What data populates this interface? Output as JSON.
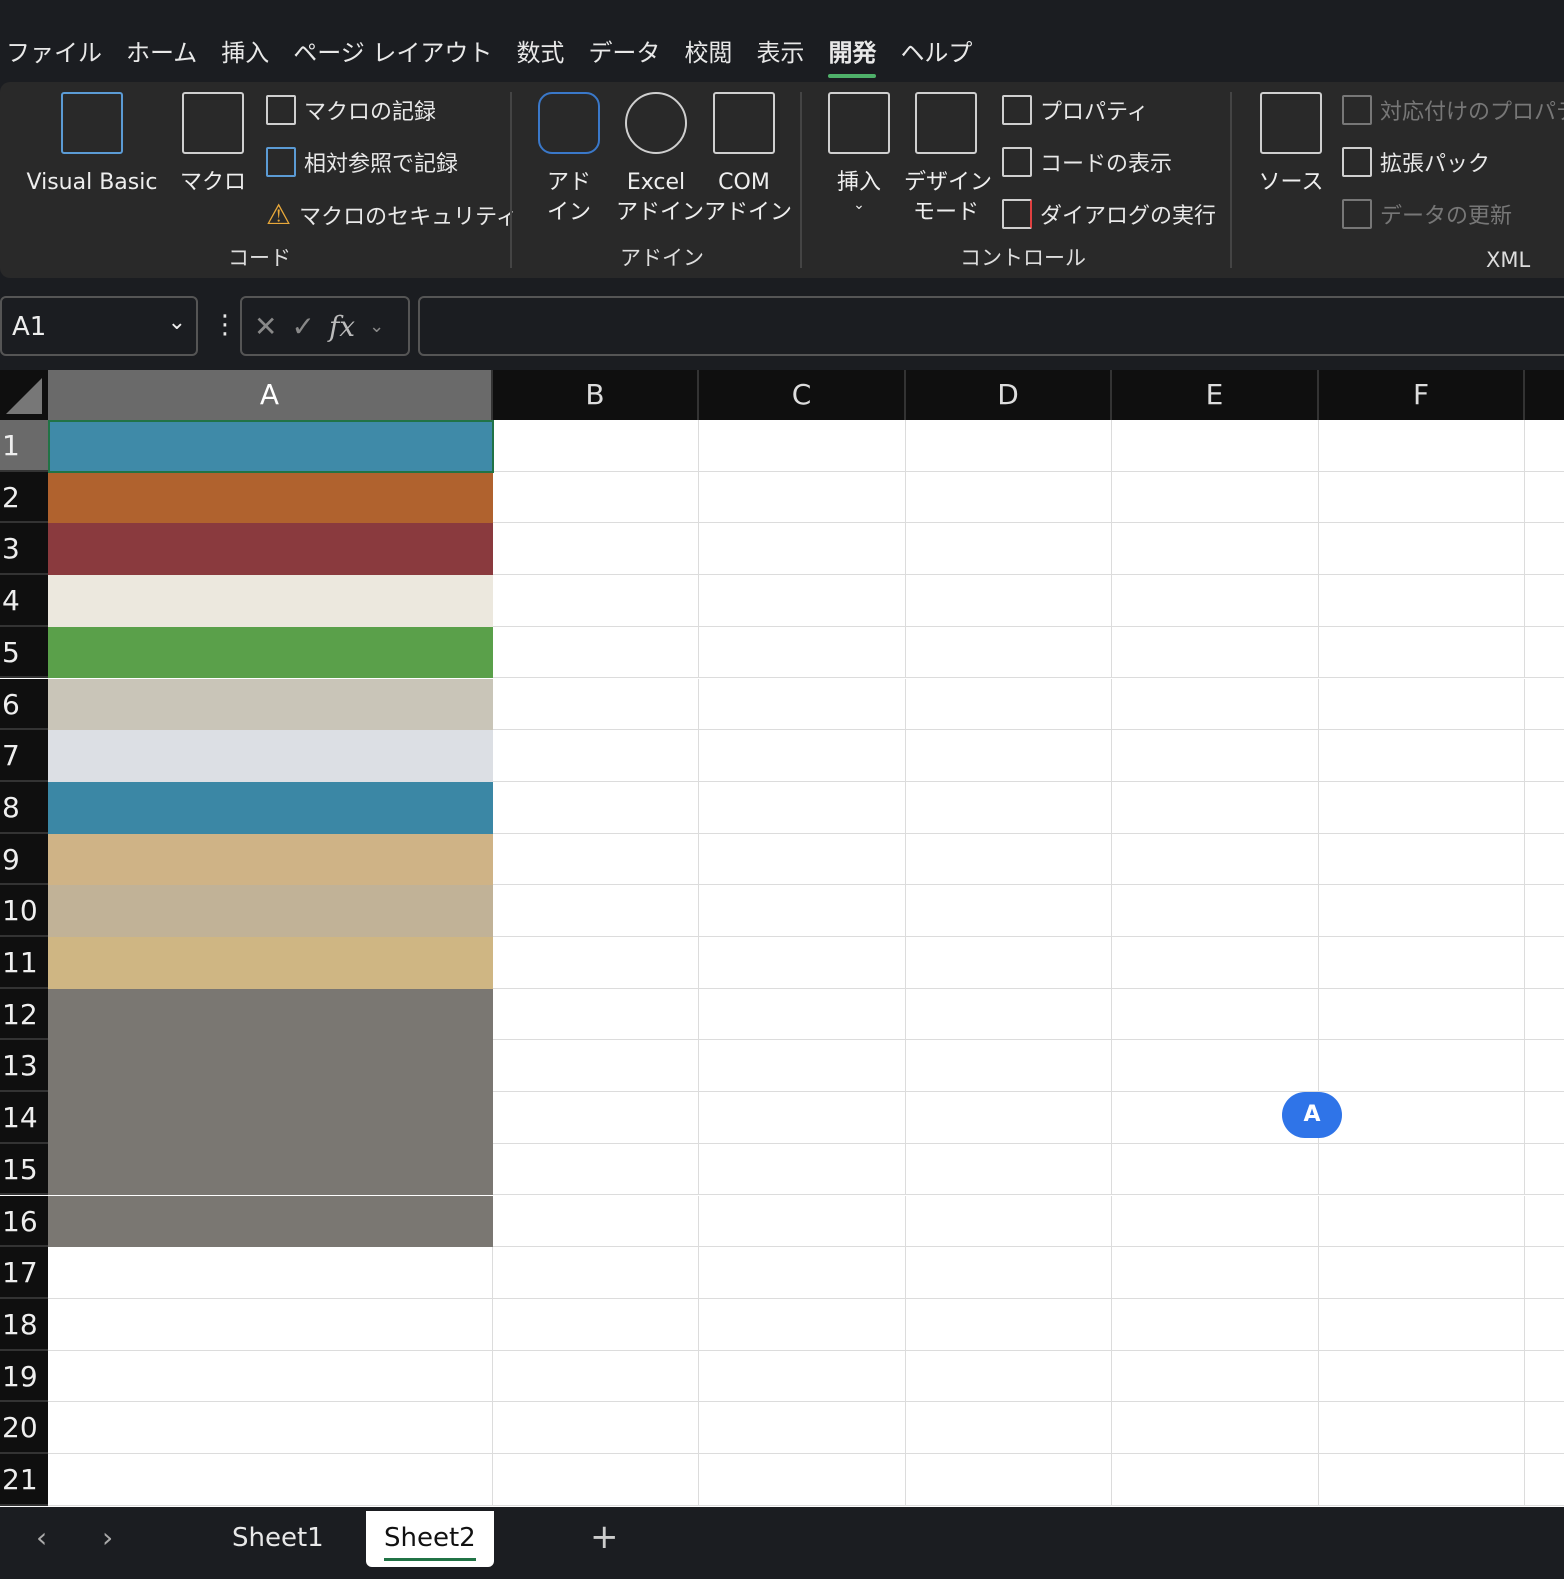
{
  "menu": [
    "ファイル",
    "ホーム",
    "挿入",
    "ページ レイアウト",
    "数式",
    "データ",
    "校閲",
    "表示",
    "開発",
    "ヘルプ"
  ],
  "active_menu": "開発",
  "ribbon": {
    "code": {
      "label": "コード",
      "visual_basic": "Visual Basic",
      "macro": "マクロ",
      "record": "マクロの記録",
      "relative": "相対参照で記録",
      "security": "マクロのセキュリティ"
    },
    "addins": {
      "label": "アドイン",
      "addin": "アド\nイン",
      "excel": "Excel\nアドイン",
      "com": "COM\nアドイン"
    },
    "controls": {
      "label": "コントロール",
      "insert": "挿入",
      "design": "デザイン\nモード",
      "properties": "プロパティ",
      "view_code": "コードの表示",
      "run_dialog": "ダイアログの実行"
    },
    "xml": {
      "label": "XML",
      "source": "ソース",
      "map_props": "対応付けのプロパティ",
      "expansion": "拡張パック",
      "refresh": "データの更新"
    }
  },
  "formula": {
    "name_box": "A1",
    "fx": "fx",
    "value": ""
  },
  "columns": [
    "A",
    "B",
    "C",
    "D",
    "E",
    "F"
  ],
  "rows": [
    "1",
    "2",
    "3",
    "4",
    "5",
    "6",
    "7",
    "8",
    "9",
    "10",
    "11",
    "12",
    "13",
    "14",
    "15",
    "16",
    "17",
    "18",
    "19",
    "20",
    "21"
  ],
  "fills": {
    "1": "#3f8aa8",
    "2": "#b0622e",
    "3": "#8a3a3e",
    "4": "#ece8de",
    "5": "#5aa04a",
    "6": "#c9c5b8",
    "7": "#dcdfe4",
    "8": "#3b87a5",
    "9": "#cfb386",
    "10": "#c1b297",
    "11": "#cfb683",
    "12": "#7a7772",
    "13": "#7a7772",
    "14": "#7a7772",
    "15": "#7a7772",
    "16": "#7a7772"
  },
  "sheets": [
    "Sheet1",
    "Sheet2"
  ],
  "active_sheet": "Sheet2",
  "badge": "A"
}
